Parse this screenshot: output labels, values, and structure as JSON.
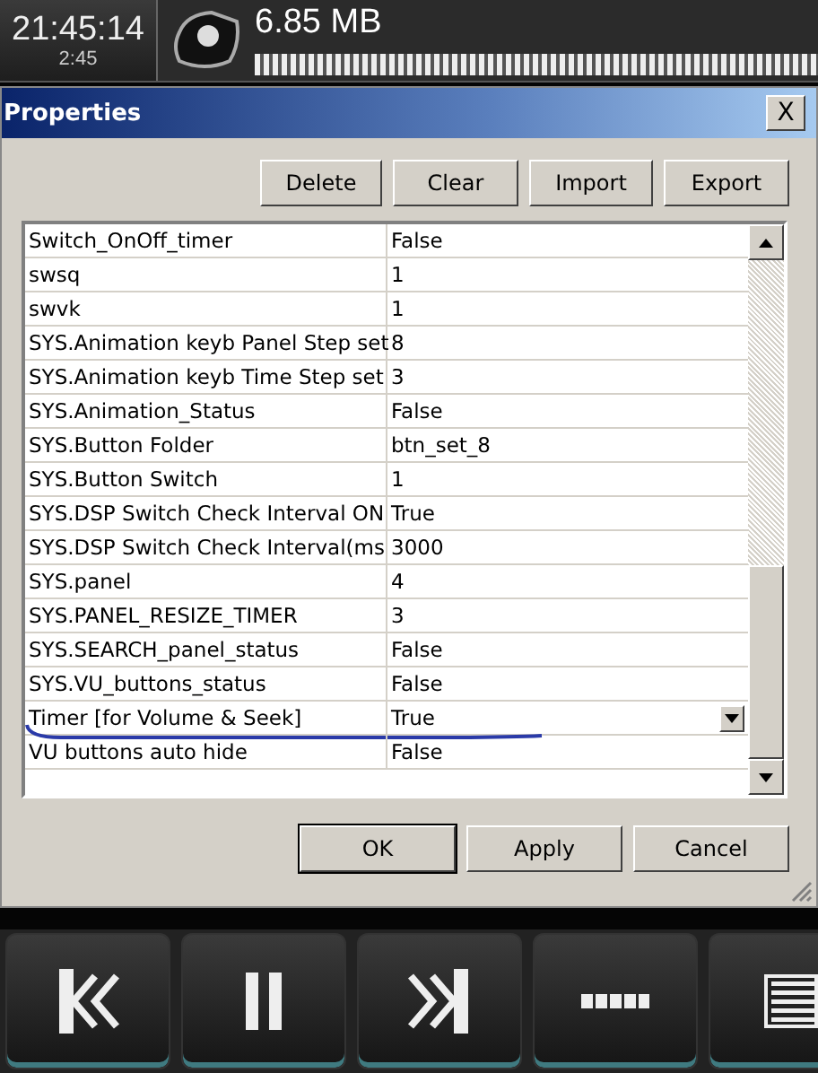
{
  "status_bar": {
    "clock": "21:45:14",
    "elapsed": "2:45",
    "memory": "6.85 MB",
    "memory_meter": {
      "level": 1
    }
  },
  "dialog": {
    "title": "Properties",
    "close": "X",
    "toolbar": [
      "Delete",
      "Clear",
      "Import",
      "Export"
    ],
    "rows": [
      {
        "name": "Switch_OnOff_timer",
        "value": "False",
        "selected": false
      },
      {
        "name": "swsq",
        "value": "1",
        "selected": false
      },
      {
        "name": "swvk",
        "value": "1",
        "selected": false
      },
      {
        "name": "SYS.Animation keyb Panel Step set",
        "value": "8",
        "selected": false
      },
      {
        "name": "SYS.Animation keyb Time Step set",
        "value": "3",
        "selected": false
      },
      {
        "name": "SYS.Animation_Status",
        "value": "False",
        "selected": false
      },
      {
        "name": "SYS.Button Folder",
        "value": "btn_set_8",
        "selected": false
      },
      {
        "name": "SYS.Button Switch",
        "value": "1",
        "selected": false
      },
      {
        "name": "SYS.DSP Switch Check Interval ON",
        "value": "True",
        "selected": false
      },
      {
        "name": "SYS.DSP Switch Check Interval(ms",
        "value": "3000",
        "selected": false
      },
      {
        "name": "SYS.panel",
        "value": "4",
        "selected": false
      },
      {
        "name": "SYS.PANEL_RESIZE_TIMER",
        "value": "3",
        "selected": false
      },
      {
        "name": "SYS.SEARCH_panel_status",
        "value": "False",
        "selected": false
      },
      {
        "name": "SYS.VU_buttons_status",
        "value": "False",
        "selected": false
      },
      {
        "name": "Timer [for Volume & Seek]",
        "value": "True",
        "selected": true
      },
      {
        "name": "VU buttons auto hide",
        "value": "False",
        "selected": false
      }
    ],
    "buttons": [
      "OK",
      "Apply",
      "Cancel"
    ]
  },
  "player": [
    {
      "kind": "previous"
    },
    {
      "kind": "pause"
    },
    {
      "kind": "next"
    },
    {
      "kind": "dots"
    },
    {
      "kind": "list"
    }
  ]
}
